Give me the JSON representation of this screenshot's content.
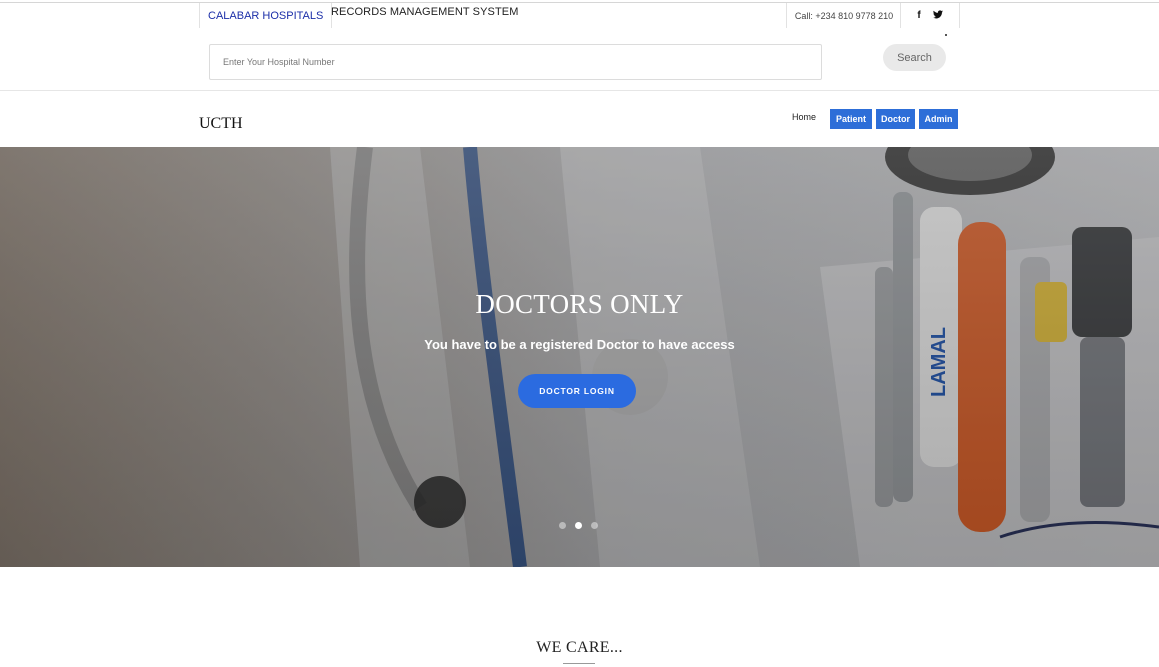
{
  "topbar": {
    "brand": "CALABAR HOSPITALS",
    "system_name": "RECORDS MANAGEMENT SYSTEM",
    "call": "Call: +234 810 9778 210",
    "social": [
      {
        "icon": "facebook-icon",
        "glyph": "f"
      },
      {
        "icon": "twitter-icon",
        "glyph": "𝕥"
      }
    ]
  },
  "search": {
    "placeholder": "Enter Your Hospital Number",
    "value": "",
    "button": "Search"
  },
  "nav": {
    "logo": "UCTH",
    "home": "Home",
    "items": [
      "Patient",
      "Doctor",
      "Admin"
    ],
    "accent": "#2d6ed8"
  },
  "hero": {
    "title": "DOCTORS ONLY",
    "subtitle": "You have to be a registered Doctor to have access",
    "cta": "DOCTOR LOGIN",
    "slides_count": 3,
    "active_slide": 2
  },
  "section": {
    "title": "WE CARE..."
  },
  "colors": {
    "brand_link": "#1b2ea8",
    "button_blue": "#2b6be0"
  }
}
